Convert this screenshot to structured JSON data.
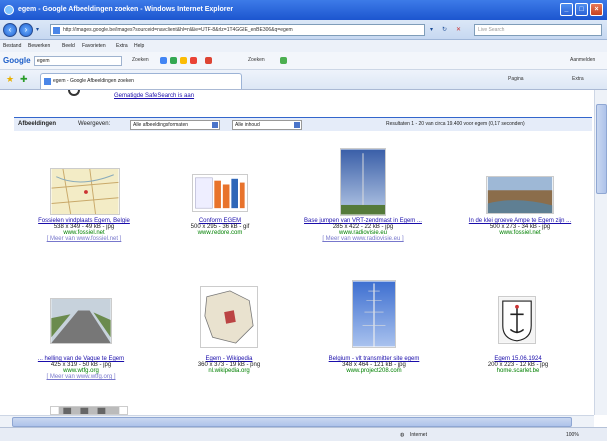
{
  "window": {
    "title": "egem - Google Afbeeldingen zoeken - Windows Internet Explorer"
  },
  "address": {
    "url": "http://images.google.be/images?sourceid=navclient&hl=nl&ie=UTF-8&rlz=1T4GGIE_enBE306&q=egem",
    "search_placeholder": "Live Search"
  },
  "menu": {
    "items": [
      "Bestand",
      "Bewerken",
      "Beeld",
      "Favorieten",
      "Extra",
      "Help"
    ]
  },
  "google_toolbar": {
    "logo": "Google",
    "query": "egem",
    "search_label": "Zoeken",
    "bookmarks_label": "Zoeken",
    "signin_label": "Aanmelden"
  },
  "tabs": {
    "active": "egem - Google Afbeeldingen zoeken",
    "home_label": "Pagina",
    "tools_label": "Extra"
  },
  "page": {
    "safesearch_link": "Gematigde SafeSearch is aan",
    "result_label": "Afbeeldingen",
    "show_label": "Weergeven:",
    "filter_formats": "Alle afbeeldingsformaten",
    "filter_content": "Alle inhoud",
    "results_summary": "Resultaten 1 - 20 van circa 19.400 voor egem (0,17 seconden)"
  },
  "results": [
    {
      "title": "Fossielen vindplaats Egem, Belgie",
      "meta": "538 x 349 - 49 kB - jpg",
      "site": "www.fossiel.net",
      "more": "[ Meer van www.fossiel.net ]"
    },
    {
      "title": "Conform EGEM",
      "meta": "500 x 295 - 36 kB - gif",
      "site": "www.redore.com",
      "more": ""
    },
    {
      "title": "Base jumpen van VRT-zendmast in Egem ...",
      "meta": "285 x 422 - 22 kB - jpg",
      "site": "www.radiovisie.eu",
      "more": "[ Meer van www.radiovisie.eu ]"
    },
    {
      "title": "In de klei groeve Ampe te Egem zijn ...",
      "meta": "500 x 273 - 34 kB - jpg",
      "site": "www.fossiel.net",
      "more": ""
    },
    {
      "title": "... helling van de Vaque te Egem",
      "meta": "425 x 319 - 50 kB - jpg",
      "site": "www.wtfg.org",
      "more": "[ Meer van www.wtfg.org ]"
    },
    {
      "title": "Egem - Wikipedia",
      "meta": "360 x 373 - 19 kB - png",
      "site": "nl.wikipedia.org",
      "more": ""
    },
    {
      "title": "Belgium - vlt transmitter site egem",
      "meta": "348 x 464 - 121 kB - jpg",
      "site": "www.project208.com",
      "more": ""
    },
    {
      "title": "Egem 15.06.1924",
      "meta": "200 x 223 - 12 kB - jpg",
      "site": "home.scarlet.be",
      "more": ""
    }
  ],
  "status": {
    "zone": "Internet",
    "zoom": "100%"
  }
}
